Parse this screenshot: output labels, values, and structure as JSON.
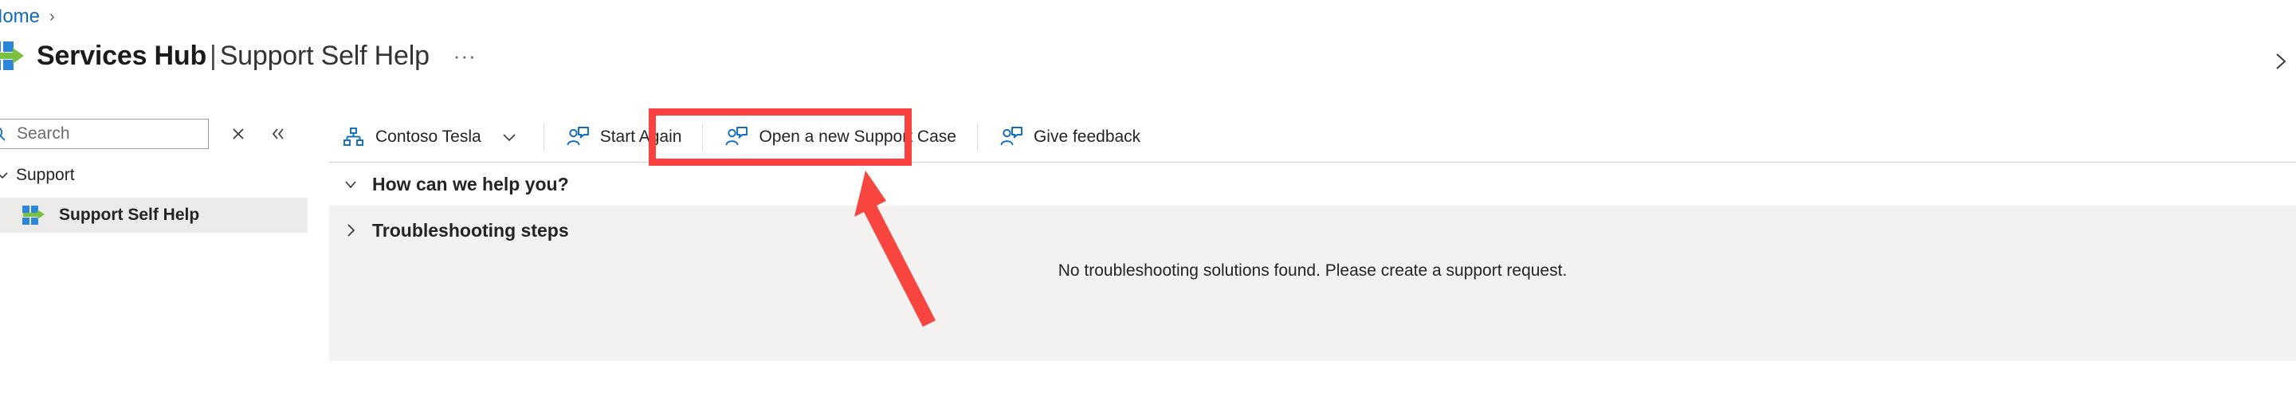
{
  "breadcrumb": {
    "items": [
      {
        "label": "Home",
        "separator": "›"
      }
    ]
  },
  "header": {
    "logo_icon": "services-hub-logo-icon",
    "title_strong": "Services Hub",
    "title_pipe": "|",
    "title_light": "Support Self Help",
    "overflow_label": "···",
    "edge_chevron_icon": "chevron-right-icon"
  },
  "sidebar": {
    "search": {
      "placeholder": "Search",
      "value": "",
      "icon": "search-icon",
      "clear_icon": "close-icon",
      "clear_label": "×",
      "collapse_icon": "double-chevron-left-icon",
      "collapse_label": "«"
    },
    "group": {
      "label": "Support",
      "chevron_icon": "chevron-down-icon",
      "expanded": true
    },
    "items": [
      {
        "label": "Support Self Help",
        "icon": "services-hub-logo-icon",
        "selected": true
      }
    ]
  },
  "toolbar": {
    "commands": [
      {
        "label": "Contoso Tesla",
        "icon": "org-hierarchy-icon",
        "has_chevron": true,
        "chevron_icon": "chevron-down-icon",
        "highlighted": false
      },
      {
        "label": "Start Again",
        "icon": "contact-support-icon",
        "has_chevron": false,
        "highlighted": false
      },
      {
        "label": "Open a new Support Case",
        "icon": "contact-support-icon",
        "has_chevron": false,
        "highlighted": true
      },
      {
        "label": "Give feedback",
        "icon": "contact-support-icon",
        "has_chevron": false,
        "highlighted": false
      }
    ]
  },
  "content": {
    "sections": [
      {
        "title": "How can we help you?",
        "expanded": true,
        "chevron_icon": "chevron-down-icon"
      },
      {
        "title": "Troubleshooting steps",
        "expanded": false,
        "chevron_icon": "chevron-right-icon"
      }
    ],
    "empty_message": "No troubleshooting solutions found. Please create a support request."
  },
  "annotations": {
    "highlight_color": "#fb4040",
    "arrow_color": "#f8453f",
    "box_target": "Open a new Support Case"
  },
  "colors": {
    "link_blue": "#0f6cbd",
    "icon_blue": "#0f6cbd",
    "logo_blue": "#2b88d8",
    "logo_green": "#7ac143",
    "panel_gray": "#f3f2f1",
    "selected_gray": "#edebe9",
    "text_primary": "#242424"
  }
}
